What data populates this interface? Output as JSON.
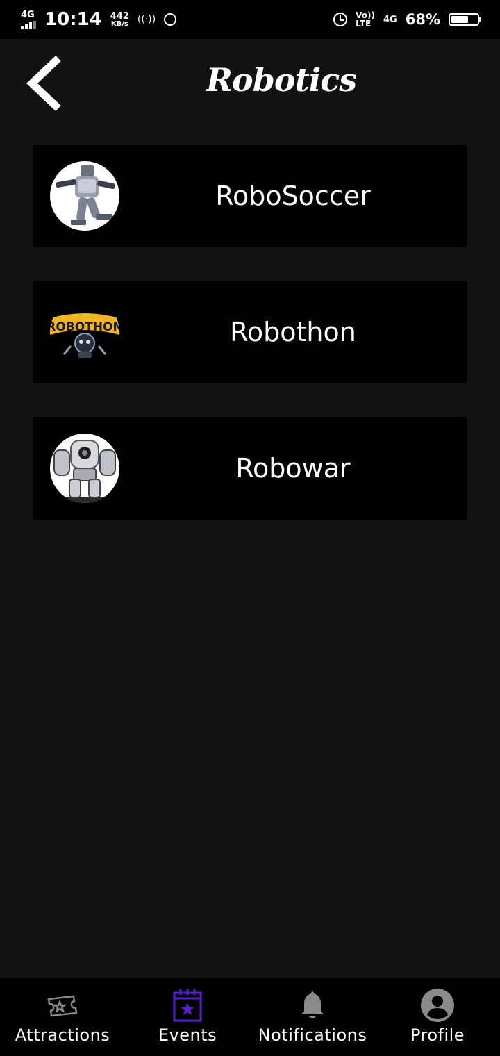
{
  "status_bar": {
    "network": "4G",
    "time": "10:14",
    "speed_value": "442",
    "speed_unit": "KB/s",
    "hotspot": "((·))",
    "volte_top": "Vo))",
    "volte_bottom": "LTE",
    "data_network": "4G",
    "battery_percent": "68%",
    "battery_level": 0.68
  },
  "header": {
    "title": "Robotics",
    "back_icon": "chevron-left-icon"
  },
  "events": [
    {
      "name": "RoboSoccer",
      "thumb_icon": "robot-soccer-image"
    },
    {
      "name": "Robothon",
      "thumb_icon": "robothon-logo-image",
      "logo_text": "ROBOTHON"
    },
    {
      "name": "Robowar",
      "thumb_icon": "robowar-robot-image"
    }
  ],
  "bottom_nav": {
    "items": [
      {
        "label": "Attractions",
        "icon": "ticket-icon",
        "active": false
      },
      {
        "label": "Events",
        "icon": "calendar-star-icon",
        "active": true
      },
      {
        "label": "Notifications",
        "icon": "bell-icon",
        "active": false
      },
      {
        "label": "Profile",
        "icon": "account-circle-icon",
        "active": false
      }
    ],
    "active_color": "#5b1fd6",
    "inactive_color": "#8a8a8a"
  },
  "colors": {
    "background": "#121212",
    "card": "#000000",
    "text": "#ffffff"
  }
}
